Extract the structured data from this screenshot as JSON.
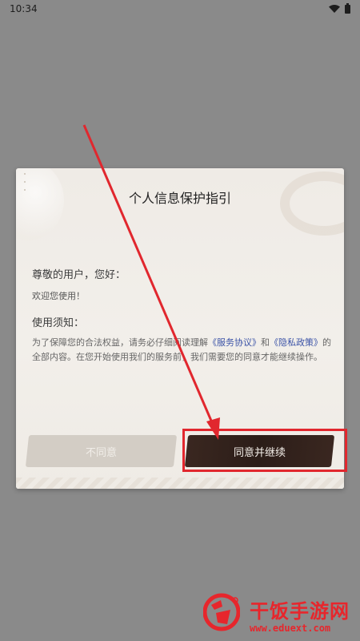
{
  "status_bar": {
    "time": "10:34"
  },
  "dialog": {
    "title": "个人信息保护指引",
    "greeting": "尊敬的用户，您好：",
    "welcome": "欢迎您使用！",
    "notice_heading": "使用须知：",
    "notice_part1": "为了保障您的合法权益，请务必仔细阅读理解",
    "service_agreement": "《服务协议》",
    "notice_and": "和",
    "privacy_policy": "《隐私政策》",
    "notice_part2": "的全部内容。在您开始使用我们的服务前，我们需要您的同意才能继续操作。"
  },
  "buttons": {
    "disagree": "不同意",
    "agree": "同意并继续"
  },
  "annotation": {
    "highlight_color": "#e1272e"
  },
  "watermark": {
    "name": "干饭手游网",
    "url": "www.eduext.com",
    "color": "#e7262c"
  }
}
